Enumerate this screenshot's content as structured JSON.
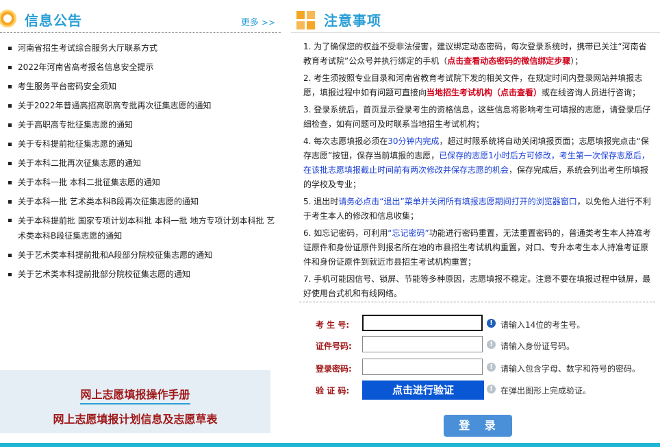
{
  "announcements": {
    "title": "信息公告",
    "more_label": "更多",
    "items": [
      "河南省招生考试综合服务大厅联系方式",
      "2022年河南省高考报名信息安全提示",
      "考生服务平台密码安全须知",
      "关于2022年普通高招高职高专批再次征集志愿的通知",
      "关于高职高专批征集志愿的通知",
      "关于专科提前批征集志愿的通知",
      "关于本科二批再次征集志愿的通知",
      "关于本科一批 本科二批征集志愿的通知",
      "关于本科一批 艺术类本科B段再次征集志愿的通知",
      "关于本科提前批 国家专项计划本科批 本科一批 地方专项计划本科批 艺术类本科B段征集志愿的通知",
      "关于艺术类本科提前批和A段部分院校征集志愿的通知",
      "关于艺术类本科提前批部分院校征集志愿的通知"
    ]
  },
  "links": {
    "manual": "网上志愿填报操作手册",
    "plan": "网上志愿填报计划信息及志愿草表"
  },
  "notice": {
    "title": "注意事项",
    "items": [
      {
        "parts": [
          {
            "t": "1. 为了确保您的权益不受非法侵害，建议绑定动态密码，每次登录系统时，携带已关注“河南省教育考试院”公众号并执行绑定的手机（",
            "c": ""
          },
          {
            "t": "点击查看动态密码的微信绑定步骤",
            "c": "red"
          },
          {
            "t": "）；",
            "c": ""
          }
        ]
      },
      {
        "parts": [
          {
            "t": "2. 考生须按照专业目录和河南省教育考试院下发的相关文件，在规定时间内登录网站并填报志愿，填报过程中如有问题可直接向",
            "c": ""
          },
          {
            "t": "当地招生考试机构（点击查看）",
            "c": "red"
          },
          {
            "t": "或在线咨询人员进行咨询；",
            "c": ""
          }
        ]
      },
      {
        "parts": [
          {
            "t": "3. 登录系统后，首页显示登录考生的资格信息，这些信息将影响考生可填报的志愿，请登录后仔细检查，如有问题可及时联系当地招生考试机构；",
            "c": ""
          }
        ]
      },
      {
        "parts": [
          {
            "t": "4. 每次志愿填报必须在",
            "c": ""
          },
          {
            "t": "30分钟内完成",
            "c": "blue"
          },
          {
            "t": "，超过时限系统将自动关闭填报页面；志愿填报完点击“保存志愿”按钮，保存当前填报的志愿，",
            "c": ""
          },
          {
            "t": "已保存的志愿1小时后方可修改，考生第一次保存志愿后，在该批志愿填报截止时间前有两次修改并保存志愿的机会",
            "c": "blue"
          },
          {
            "t": "，保存完成后，系统会列出考生所填报的学校及专业；",
            "c": ""
          }
        ]
      },
      {
        "parts": [
          {
            "t": "5. 退出时",
            "c": ""
          },
          {
            "t": "请务必点击“退出”菜单并关闭所有填报志愿期间打开的浏览器窗口",
            "c": "blue"
          },
          {
            "t": "，以免他人进行不利于考生本人的修改和信息收集；",
            "c": ""
          }
        ]
      },
      {
        "parts": [
          {
            "t": "6. 如忘记密码，可利用",
            "c": ""
          },
          {
            "t": "“忘记密码”",
            "c": "blue"
          },
          {
            "t": "功能进行密码重置，无法重置密码的，普通类考生本人持准考证原件和身份证原件到报名所在地的市县招生考试机构重置，对口、专升本考生本人持准考证原件和身份证原件到就近市县招生考试机构重置；",
            "c": ""
          }
        ]
      },
      {
        "parts": [
          {
            "t": "7. 手机可能因信号、锁屏、节能等多种原因，志愿填报不稳定。注意不要在填报过程中锁屏，最好使用台式机和有线网络。",
            "c": ""
          }
        ]
      }
    ]
  },
  "form": {
    "exam_no_label": "考 生 号:",
    "exam_no_hint": "请输入14位的考生号。",
    "id_label": "证件号码:",
    "id_hint": "请输入身份证号码。",
    "password_label": "登录密码:",
    "password_hint": "请输入包含字母、数字和符号的密码。",
    "verify_label": "验 证 码:",
    "verify_button": "点击进行验证",
    "verify_hint": "在弹出图形上完成验证。",
    "login_button": "登 录"
  },
  "colors": {
    "accent": "#2a9fd6",
    "link_red": "#a01818",
    "verify_blue": "#0a57d6",
    "login_blue": "#4a90d9"
  }
}
